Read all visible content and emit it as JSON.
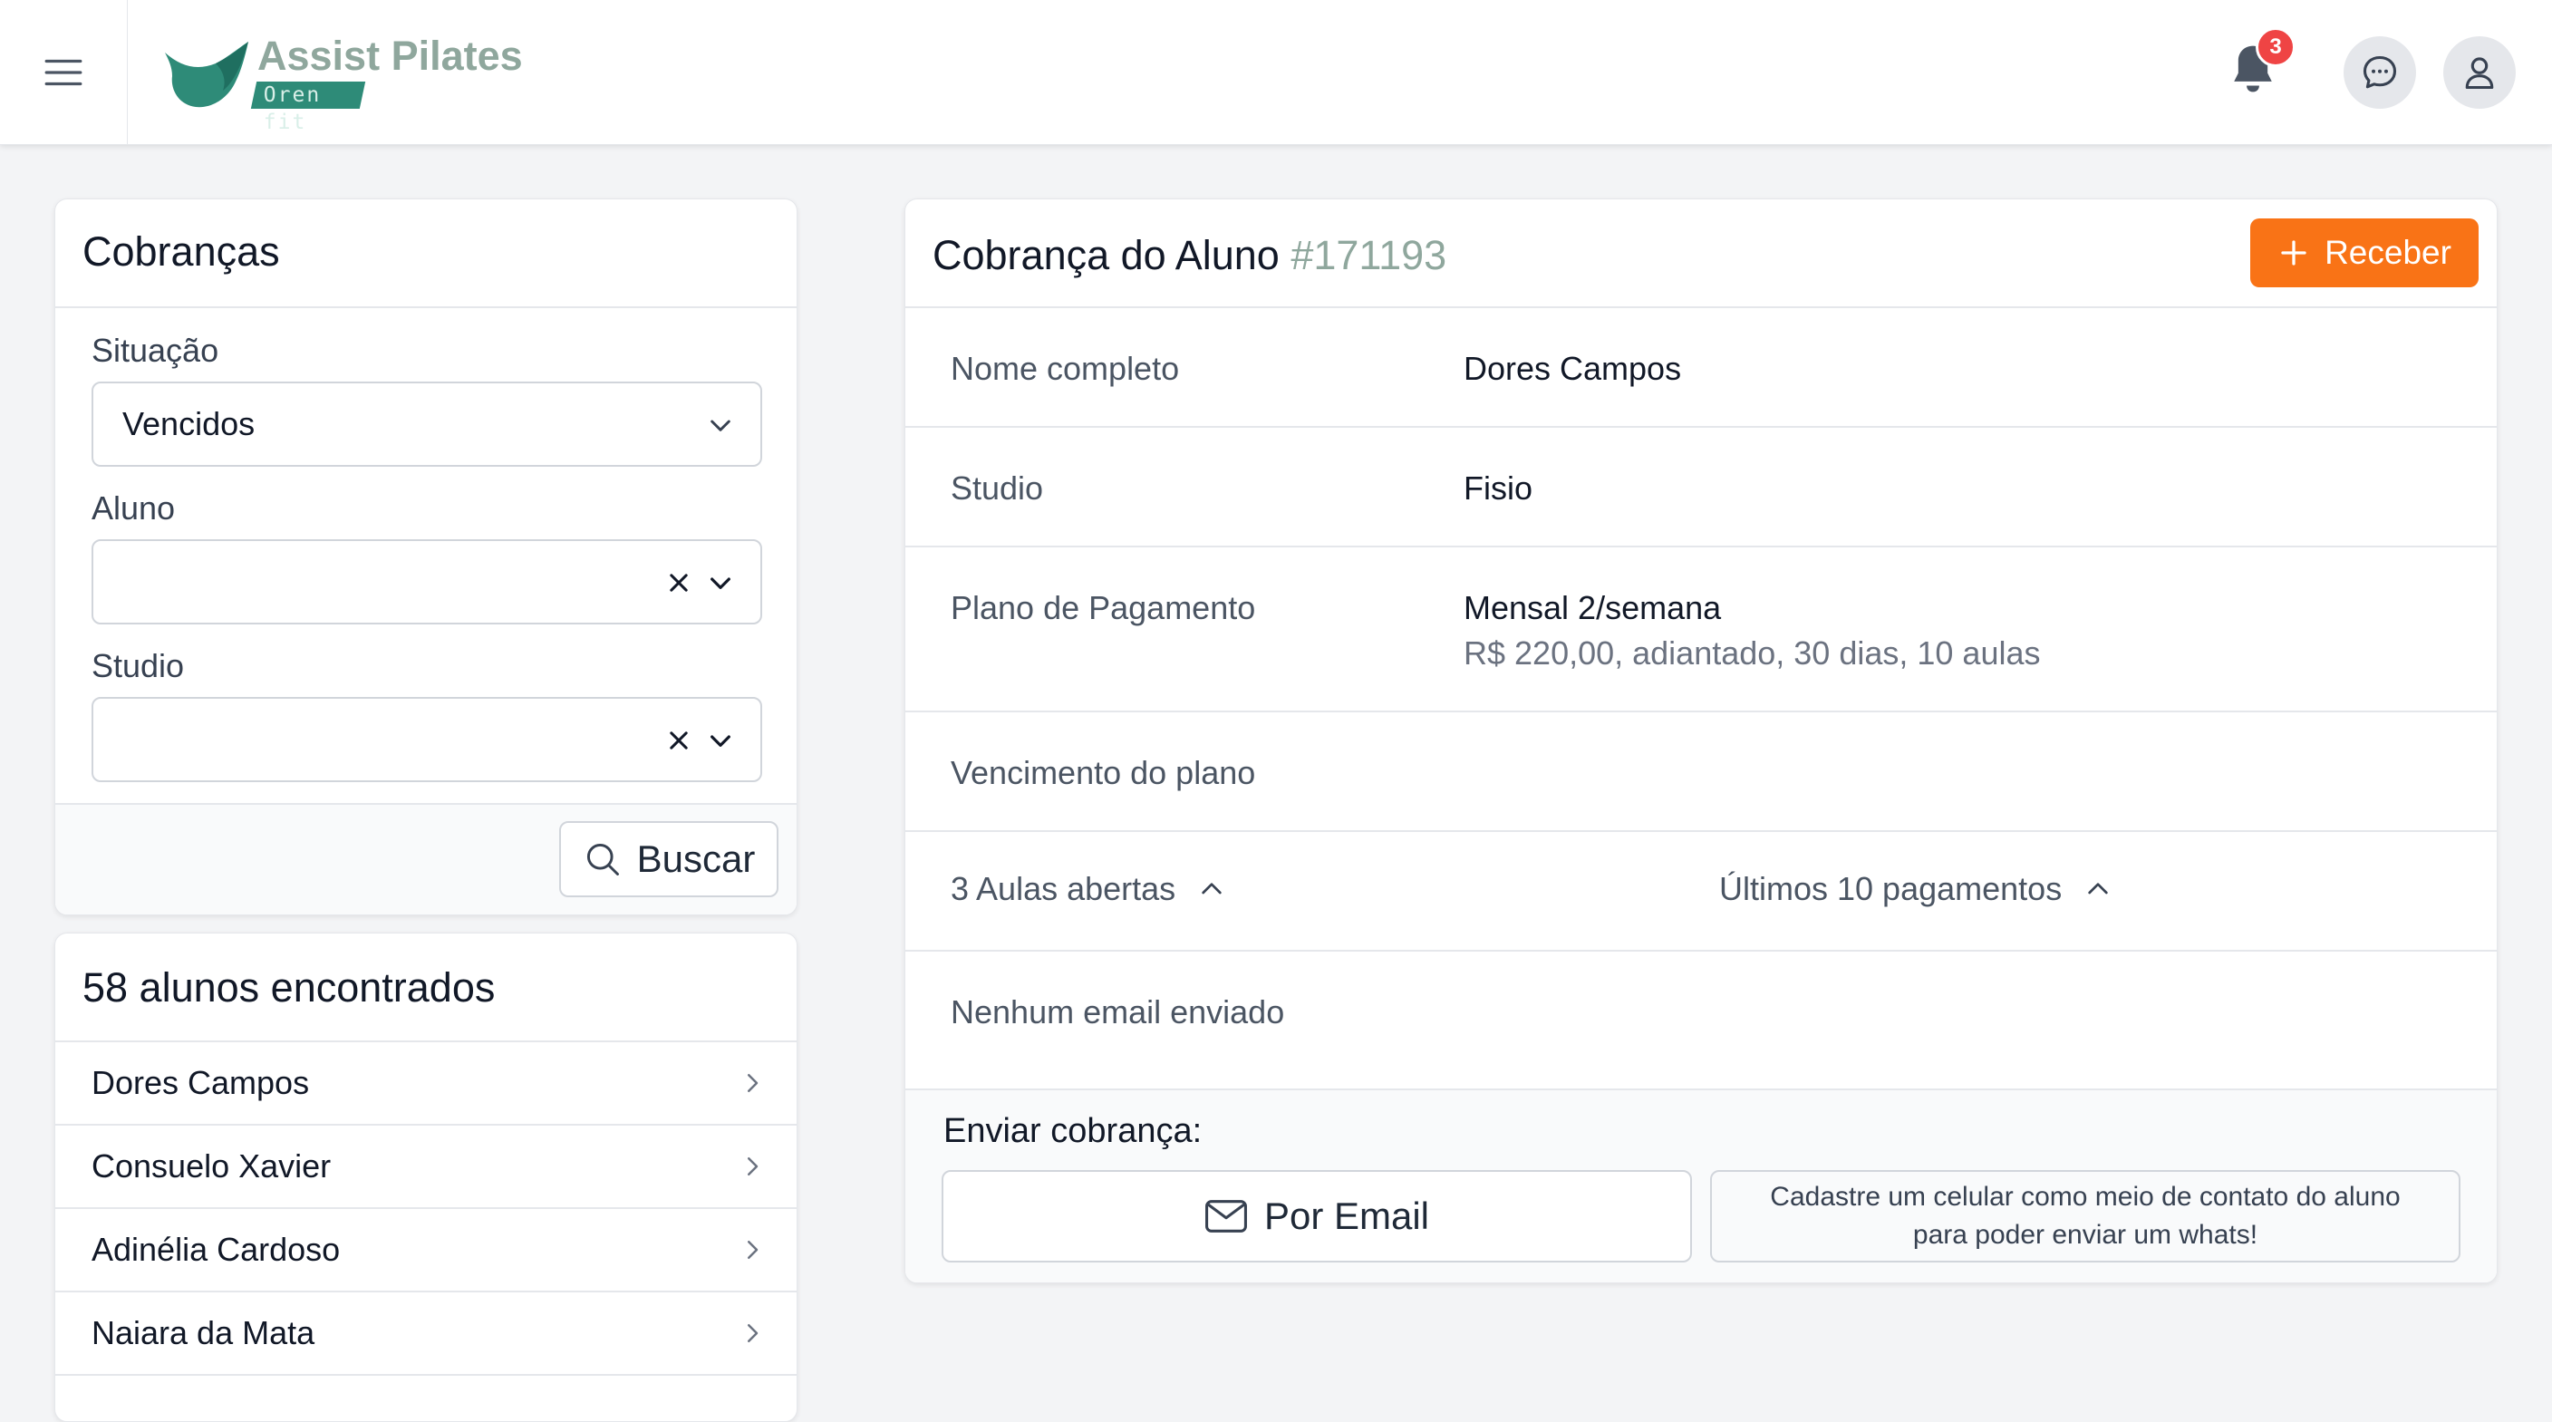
{
  "app": {
    "name": "Assist Pilates",
    "sub": "Oren fit",
    "notification_count": "3",
    "colors": {
      "accent": "#f97316",
      "brand": "#2e8b78",
      "muted_green": "#8fa79d",
      "badge": "#ef4444"
    }
  },
  "filter": {
    "title": "Cobranças",
    "situacao_label": "Situação",
    "situacao_value": "Vencidos",
    "aluno_label": "Aluno",
    "aluno_value": "",
    "studio_label": "Studio",
    "studio_value": "",
    "search_label": "Buscar"
  },
  "results": {
    "title": "58 alunos encontrados",
    "items": [
      "Dores Campos",
      "Consuelo Xavier",
      "Adinélia Cardoso",
      "Naiara da Mata"
    ]
  },
  "detail": {
    "title": "Cobrança do Aluno",
    "id": "#171193",
    "receive_label": "Receber",
    "nome_label": "Nome completo",
    "nome_value": "Dores Campos",
    "studio_label": "Studio",
    "studio_value": "Fisio",
    "plano_label": "Plano de Pagamento",
    "plano_value": "Mensal 2/semana",
    "plano_details": "R$ 220,00, adiantado, 30 dias, 10 aulas",
    "vencimento_label": "Vencimento do plano",
    "aulas_toggle": "3 Aulas abertas",
    "pagamentos_toggle": "Últimos 10 pagamentos",
    "email_status": "Nenhum email enviado",
    "send_title": "Enviar cobrança:",
    "send_email_label": "Por Email",
    "whats_message": "Cadastre um celular como meio de contato do aluno para poder enviar um whats!"
  }
}
